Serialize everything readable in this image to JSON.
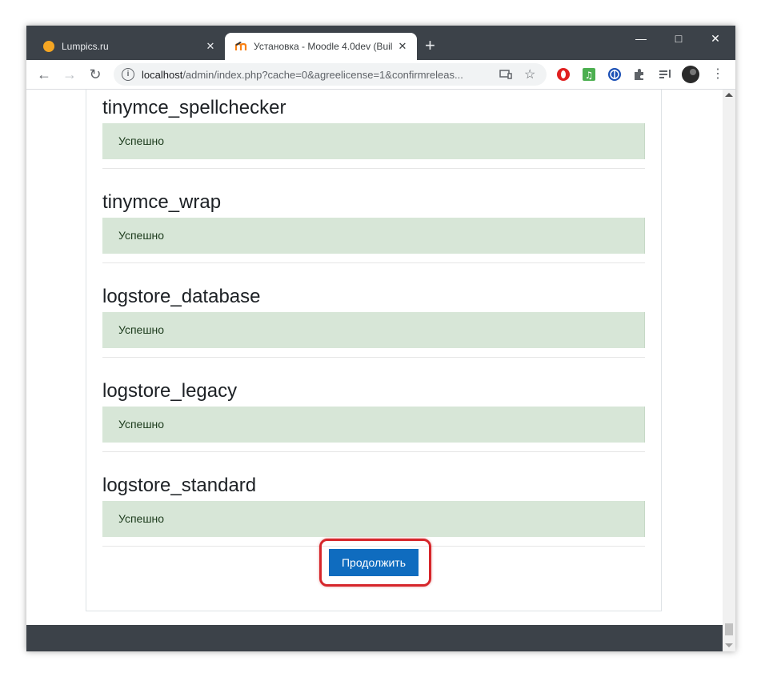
{
  "browser": {
    "tabs": [
      {
        "title": "Lumpics.ru",
        "active": false,
        "icon": "orange-circle-icon"
      },
      {
        "title": "Установка - Moodle 4.0dev (Buil",
        "active": true,
        "icon": "moodle-icon"
      }
    ],
    "new_tab_label": "+",
    "url_host": "localhost",
    "url_path": "/admin/index.php?cache=0&agreelicense=1&confirmreleas...",
    "colors": {
      "frame": "#3c4249",
      "accent_red": "#d6262b"
    }
  },
  "page": {
    "plugins": [
      {
        "name": "tinymce_spellchecker",
        "status": "Успешно"
      },
      {
        "name": "tinymce_wrap",
        "status": "Успешно"
      },
      {
        "name": "logstore_database",
        "status": "Успешно"
      },
      {
        "name": "logstore_legacy",
        "status": "Успешно"
      },
      {
        "name": "logstore_standard",
        "status": "Успешно"
      }
    ],
    "continue_label": "Продолжить",
    "colors": {
      "success_bg": "#d7e6d7",
      "button": "#0f6cbf"
    }
  }
}
